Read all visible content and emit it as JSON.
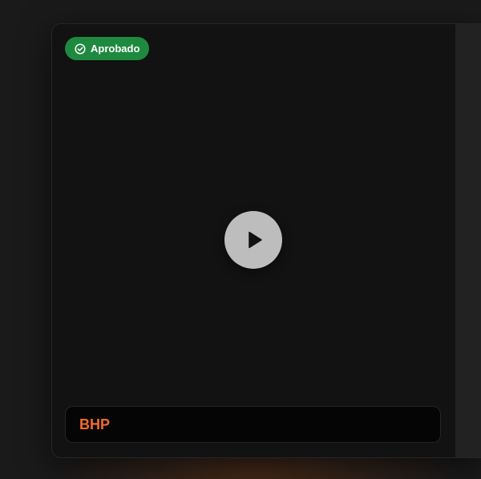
{
  "card": {
    "status_badge": {
      "label": "Aprobado",
      "icon": "check-circle-icon",
      "color": "#1e8a3f"
    },
    "video": {
      "play_icon": "play-icon"
    },
    "title": "BHP"
  },
  "colors": {
    "accent": "#f26b2f",
    "approved": "#1e8a3f"
  }
}
